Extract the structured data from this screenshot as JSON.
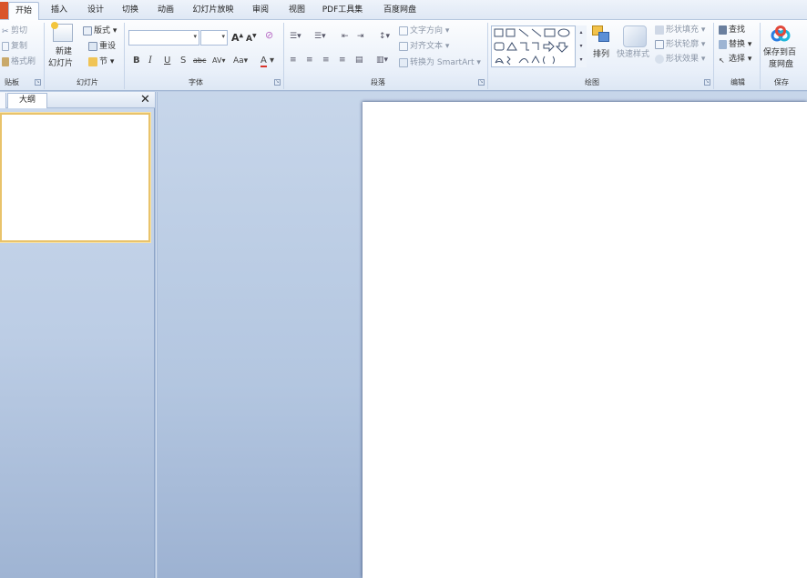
{
  "tabs": [
    {
      "label": "开始",
      "active": true
    },
    {
      "label": "插入",
      "active": false
    },
    {
      "label": "设计",
      "active": false
    },
    {
      "label": "切换",
      "active": false
    },
    {
      "label": "动画",
      "active": false
    },
    {
      "label": "幻灯片放映",
      "active": false
    },
    {
      "label": "审阅",
      "active": false
    },
    {
      "label": "视图",
      "active": false
    },
    {
      "label": "PDF工具集",
      "active": false
    },
    {
      "label": "百度网盘",
      "active": false
    }
  ],
  "clipboard": {
    "cut": "剪切",
    "copy": "复制",
    "format_painter": "格式刷",
    "group_label": "贴板"
  },
  "slides": {
    "new_slide_line1": "新建",
    "new_slide_line2": "幻灯片",
    "layout": "版式",
    "reset": "重设",
    "section": "节",
    "group_label": "幻灯片"
  },
  "font": {
    "grow": "A",
    "shrink": "A",
    "bold": "B",
    "italic": "I",
    "underline": "U",
    "strike": "S",
    "shadow": "abc",
    "spacing": "AV",
    "case": "Aa",
    "color": "A",
    "group_label": "字体"
  },
  "paragraph": {
    "text_direction": "文字方向",
    "align_text": "对齐文本",
    "convert_smartart": "转换为 SmartArt",
    "group_label": "段落"
  },
  "drawing": {
    "arrange": "排列",
    "quick_styles": "快速样式",
    "shape_fill": "形状填充",
    "shape_outline": "形状轮廓",
    "shape_effects": "形状效果",
    "group_label": "绘图"
  },
  "editing": {
    "find": "查找",
    "replace": "替换",
    "select": "选择",
    "group_label": "编辑"
  },
  "save": {
    "line1": "保存到百",
    "line2": "度网盘",
    "group_label": "保存"
  },
  "left_panel": {
    "tab_outline": "大纲",
    "close": "✕"
  },
  "colors": {
    "file_tab": "#d9542b",
    "thumbnail_border": "#e9c36b",
    "baidu_blue": "#2a7de1"
  }
}
